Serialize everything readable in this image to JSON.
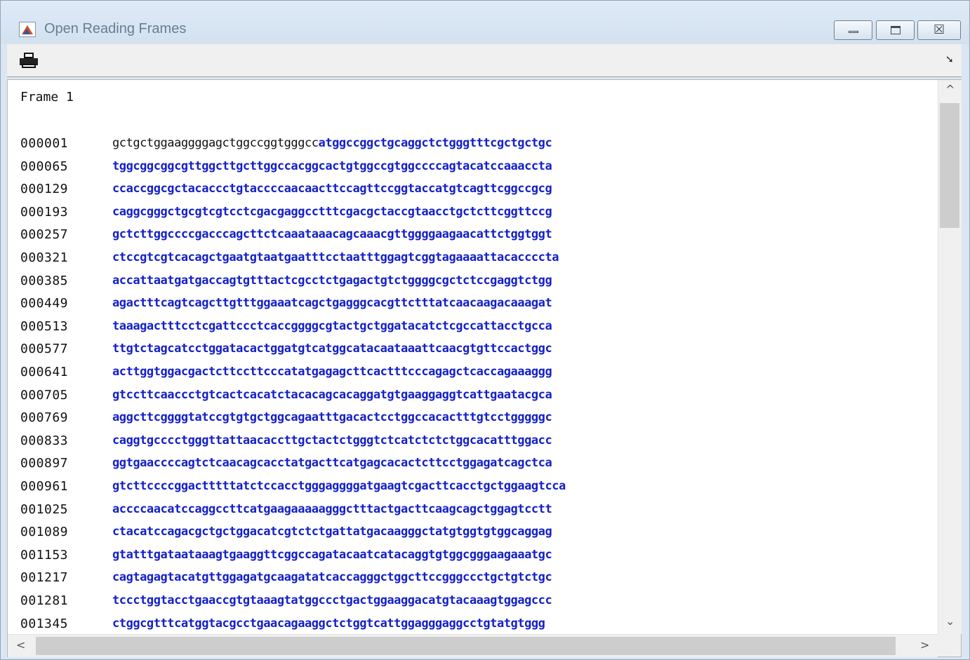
{
  "window": {
    "title": "Open Reading Frames",
    "icon": "matlab-icon",
    "controls": {
      "minimize": "minimize-icon",
      "maximize": "maximize-icon",
      "close_glyph": "☒"
    }
  },
  "toolbar": {
    "print_icon": "printer-icon",
    "dock_icon": "undock-arrow-icon",
    "dock_glyph": "➘"
  },
  "content": {
    "frame_label": "Frame 1",
    "rows": [
      {
        "index": "000001",
        "pre": "gctgctggaaggggagctggccggtgggcc",
        "orf": "atggccggctgcaggctctgggtttcgctgctgc"
      },
      {
        "index": "000065",
        "pre": "",
        "orf": "tggcggcggcgttggcttgcttggccacggcactgtggccgtggccccagtacatccaaaccta"
      },
      {
        "index": "000129",
        "pre": "",
        "orf": "ccaccggcgctacaccctgtaccccaacaacttccagttccggtaccatgtcagttcggccgcg"
      },
      {
        "index": "000193",
        "pre": "",
        "orf": "caggcgggctgcgtcgtcctcgacgaggcctttcgacgctaccgtaacctgctcttcggttccg"
      },
      {
        "index": "000257",
        "pre": "",
        "orf": "gctcttggccccgacccagcttctcaaataaacagcaaacgttggggaagaacattctggtggt"
      },
      {
        "index": "000321",
        "pre": "",
        "orf": "ctccgtcgtcacagctgaatgtaatgaatttcctaatttggagtcggtagaaaattacaccccta"
      },
      {
        "index": "000385",
        "pre": "",
        "orf": "accattaatgatgaccagtgtttactcgcctctgagactgtctggggcgctctccgaggtctgg"
      },
      {
        "index": "000449",
        "pre": "",
        "orf": "agactttcagtcagcttgtttggaaatcagctgagggcacgttctttatcaacaagacaaagat"
      },
      {
        "index": "000513",
        "pre": "",
        "orf": "taaagactttcctcgattccctcaccggggcgtactgctggatacatctcgccattacctgcca"
      },
      {
        "index": "000577",
        "pre": "",
        "orf": "ttgtctagcatcctggatacactggatgtcatggcatacaataaattcaacgtgttccactggc"
      },
      {
        "index": "000641",
        "pre": "",
        "orf": "acttggtggacgactcttccttcccatatgagagcttcactttcccagagctcaccagaaaggg"
      },
      {
        "index": "000705",
        "pre": "",
        "orf": "gtccttcaaccctgtcactcacatctacacagcacaggatgtgaaggaggtcattgaatacgca"
      },
      {
        "index": "000769",
        "pre": "",
        "orf": "aggcttcggggtatccgtgtgctggcagaatttgacactcctggccacactttgtcctgggggc"
      },
      {
        "index": "000833",
        "pre": "",
        "orf": "caggtgcccctgggttattaacaccttgctactctgggtctcatctctctggcacatttggacc"
      },
      {
        "index": "000897",
        "pre": "",
        "orf": "ggtgaaccccagtctcaacagcacctatgacttcatgagcacactcttcctggagatcagctca"
      },
      {
        "index": "000961",
        "pre": "",
        "orf": "gtcttccccggactttttatctccacctgggaggggatgaagtcgacttcacctgctggaagtcca"
      },
      {
        "index": "001025",
        "pre": "",
        "orf": "accccaacatccaggccttcatgaagaaaaagggctttactgacttcaagcagctggagtcctt"
      },
      {
        "index": "001089",
        "pre": "",
        "orf": "ctacatccagacgctgctggacatcgtctctgattatgacaagggctatgtggtgtggcaggag"
      },
      {
        "index": "001153",
        "pre": "",
        "orf": "gtatttgataataaagtgaaggttcggccagatacaatcatacaggtgtggcgggaagaaatgc"
      },
      {
        "index": "001217",
        "pre": "",
        "orf": "cagtagagtacatgttggagatgcaagatatcaccagggctggcttccgggccctgctgtctgc"
      },
      {
        "index": "001281",
        "pre": "",
        "orf": "tccctggtacctgaaccgtgtaaagtatggccctgactggaaggacatgtacaaagtggagccc"
      },
      {
        "index": "001345",
        "pre": "",
        "orf": "ctggcgtttcatggtacgcctgaacagaaggctctggtcattggagggaggcctgtatgtggg"
      }
    ]
  },
  "scrollbars": {
    "up_glyph": "^",
    "down_glyph": "⌄",
    "left_glyph": "<",
    "right_glyph": ">"
  }
}
